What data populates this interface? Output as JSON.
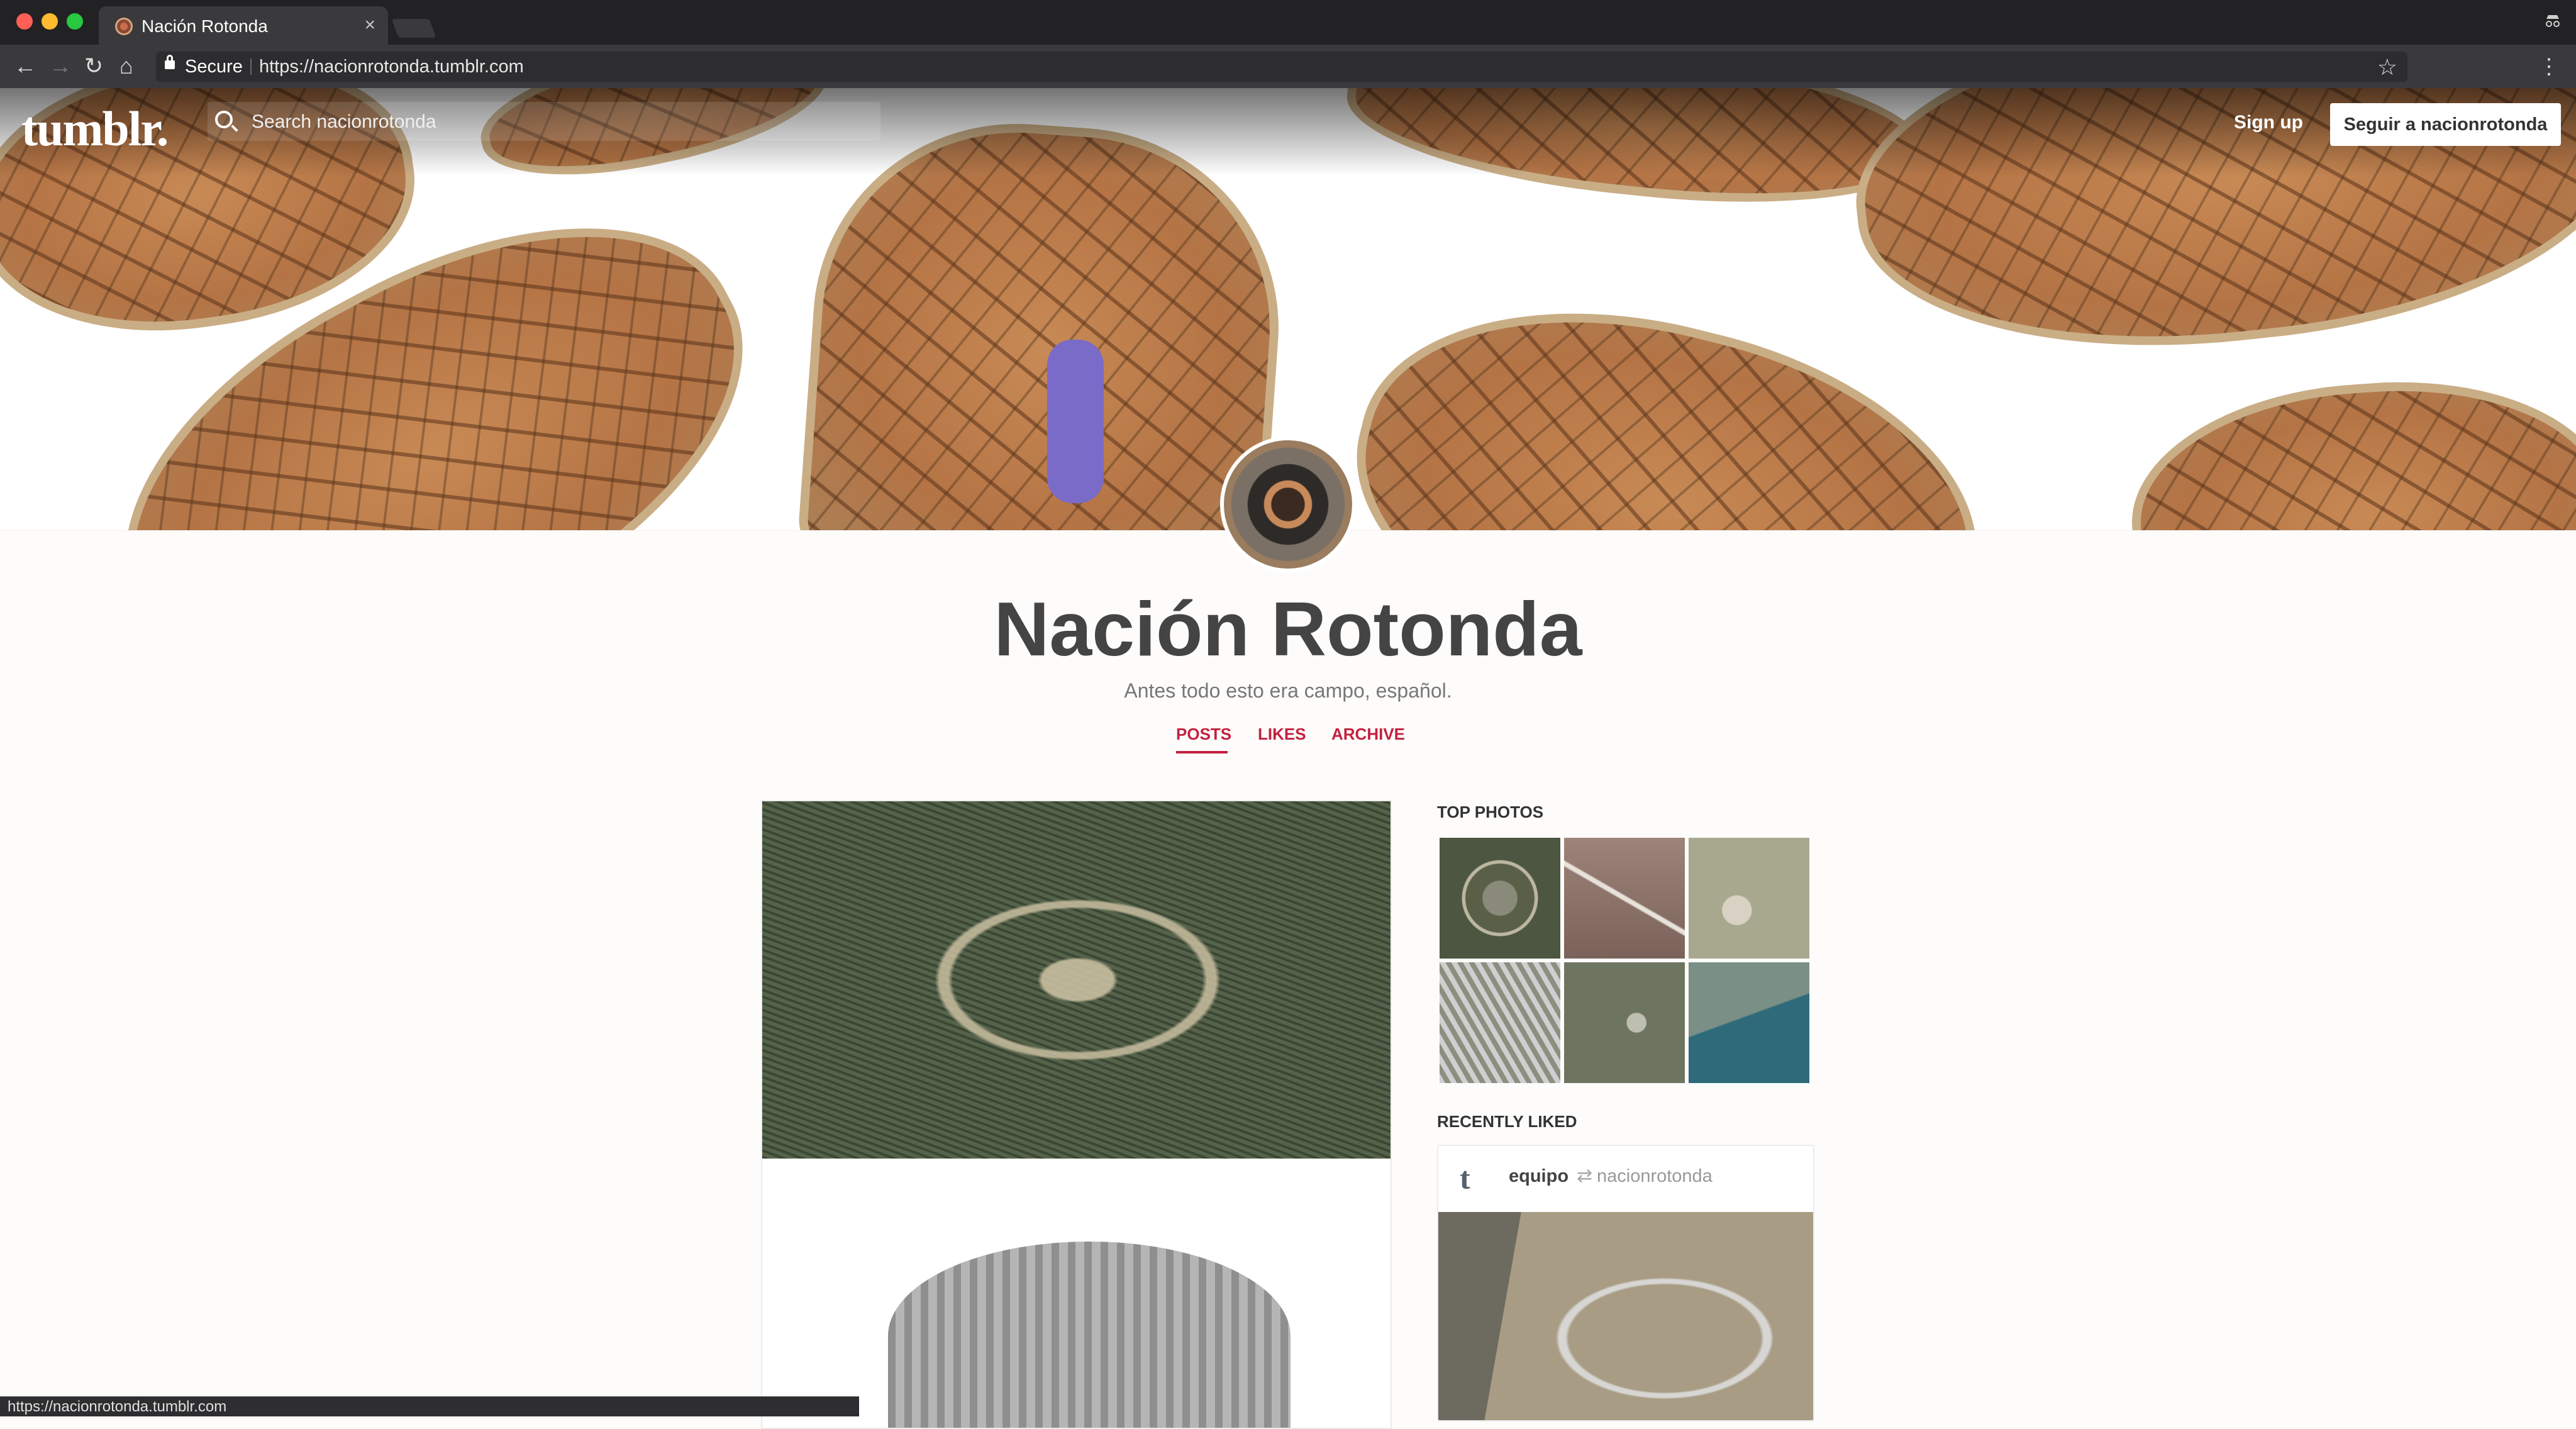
{
  "browser": {
    "tab_title": "Nación Rotonda",
    "secure_label": "Secure",
    "url": "https://nacionrotonda.tumblr.com",
    "status_url": "https://nacionrotonda.tumblr.com"
  },
  "header": {
    "logo": "tumblr.",
    "search_placeholder": "Search nacionrotonda",
    "signup_label": "Sign up",
    "follow_label": "Seguir a nacionrotonda"
  },
  "blog": {
    "title": "Nación Rotonda",
    "description": "Antes todo esto era campo, español.",
    "nav": [
      "POSTS",
      "LIKES",
      "ARCHIVE"
    ],
    "active_nav": "POSTS"
  },
  "sidebar": {
    "top_photos_heading": "TOP PHOTOS",
    "recently_liked_heading": "RECENTLY LIKED",
    "recently_liked": {
      "user": "equipo",
      "source": "nacionrotonda"
    }
  },
  "colors": {
    "accent": "#c3213f",
    "chrome_dark": "#222224",
    "chrome_toolbar": "#3a3a3c"
  }
}
